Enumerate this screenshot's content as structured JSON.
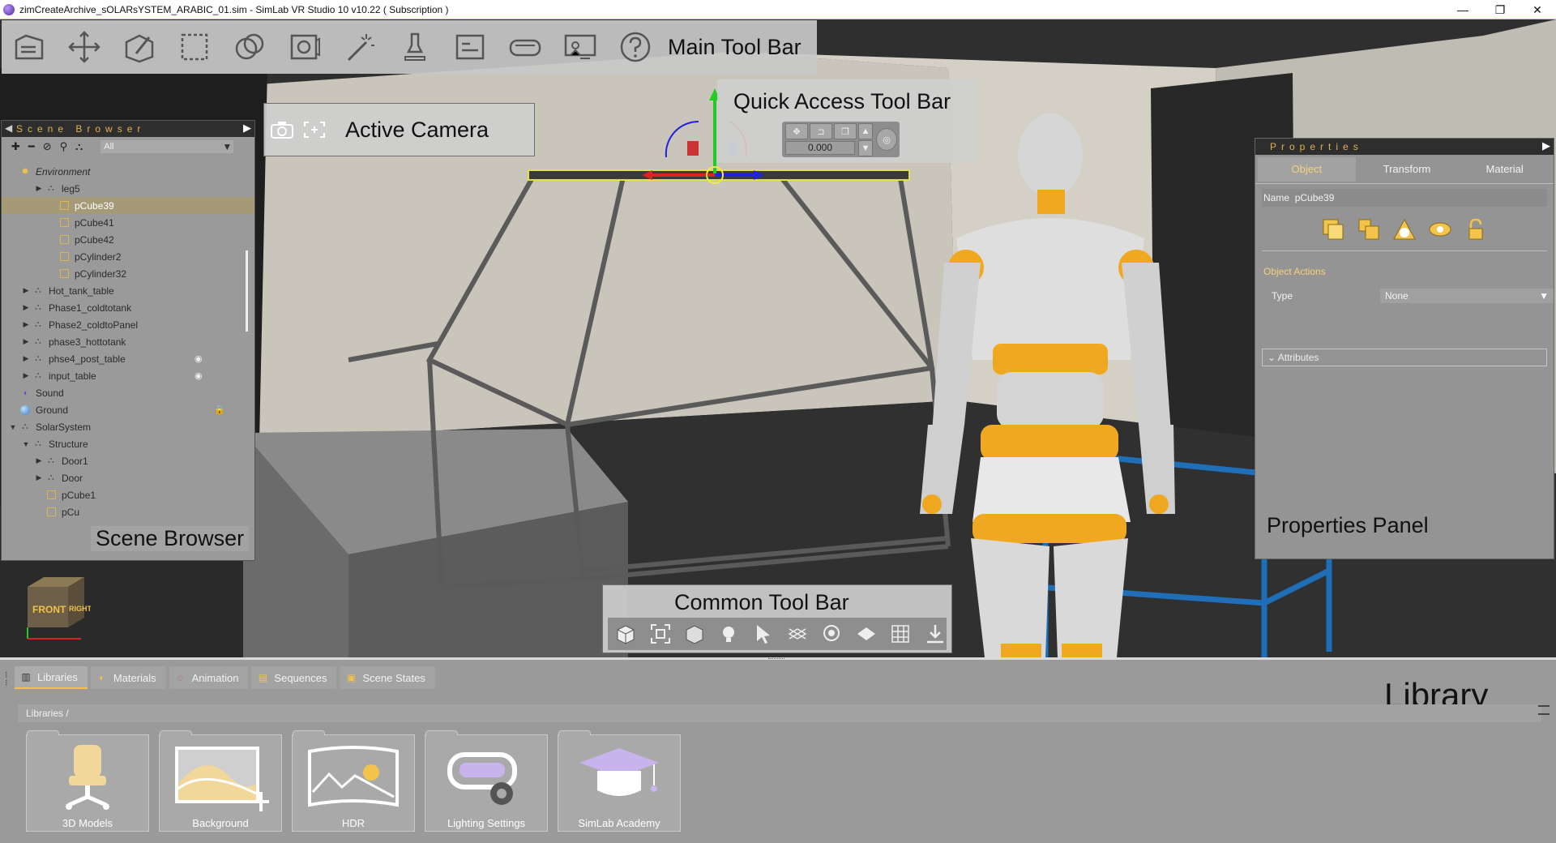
{
  "window": {
    "title": "zimCreateArchive_sOLARsYSTEM_ARABIC_01.sim - SimLab VR Studio 10 v10.22 ( Subscription )",
    "minimize": "—",
    "maximize": "❐",
    "close": "✕"
  },
  "labels": {
    "main_toolbar": "Main Tool Bar",
    "quick_access": "Quick Access Tool Bar",
    "active_camera": "Active Camera",
    "scene_browser": "Scene Browser",
    "properties_panel": "Properties Panel",
    "common_toolbar": "Common Tool Bar",
    "library": "Library"
  },
  "main_toolbar_icons": [
    "folder-icon",
    "move-icon",
    "edit-icon",
    "select-box-icon",
    "materials-icon",
    "camera-render-icon",
    "magic-wand-icon",
    "light-icon",
    "sequence-icon",
    "vr-headset-icon",
    "presentation-icon",
    "help-icon"
  ],
  "quick_access": {
    "value": "0.000"
  },
  "scene_browser": {
    "title": "Scene Browser",
    "filter": "All",
    "tree": [
      {
        "label": "Environment",
        "depth": 0,
        "icon": "sun-icon",
        "arrow": "",
        "italic": true
      },
      {
        "label": "leg5",
        "depth": 2,
        "icon": "group-icon",
        "arrow": "▶"
      },
      {
        "label": "pCube39",
        "depth": 3,
        "icon": "cube-icon",
        "arrow": "",
        "selected": true
      },
      {
        "label": "pCube41",
        "depth": 3,
        "icon": "cube-icon",
        "arrow": ""
      },
      {
        "label": "pCube42",
        "depth": 3,
        "icon": "cube-icon",
        "arrow": ""
      },
      {
        "label": "pCylinder2",
        "depth": 3,
        "icon": "cube-icon",
        "arrow": ""
      },
      {
        "label": "pCylinder32",
        "depth": 3,
        "icon": "cube-icon",
        "arrow": ""
      },
      {
        "label": "Hot_tank_table",
        "depth": 1,
        "icon": "group-icon",
        "arrow": "▶"
      },
      {
        "label": "Phase1_coldtotank",
        "depth": 1,
        "icon": "group-icon",
        "arrow": "▶"
      },
      {
        "label": "Phase2_coldtoPanel",
        "depth": 1,
        "icon": "group-icon",
        "arrow": "▶"
      },
      {
        "label": "phase3_hottotank",
        "depth": 1,
        "icon": "group-icon",
        "arrow": "▶"
      },
      {
        "label": "phse4_post_table",
        "depth": 1,
        "icon": "group-icon",
        "arrow": "▶",
        "badge": "eye-icon"
      },
      {
        "label": "input_table",
        "depth": 1,
        "icon": "group-icon",
        "arrow": "▶",
        "badge": "eye-icon"
      },
      {
        "label": "Sound",
        "depth": 0,
        "icon": "sound-icon",
        "arrow": ""
      },
      {
        "label": "Ground",
        "depth": 0,
        "icon": "globe-icon",
        "arrow": "",
        "badge": "lock-icon"
      },
      {
        "label": "SolarSystem",
        "depth": 0,
        "icon": "group-icon",
        "arrow": "▼"
      },
      {
        "label": "Structure",
        "depth": 1,
        "icon": "group-icon",
        "arrow": "▼"
      },
      {
        "label": "Door1",
        "depth": 2,
        "icon": "group-icon",
        "arrow": "▶"
      },
      {
        "label": "Door",
        "depth": 2,
        "icon": "group-icon",
        "arrow": "▶"
      },
      {
        "label": "pCube1",
        "depth": 2,
        "icon": "cube-icon",
        "arrow": ""
      },
      {
        "label": "pCu",
        "depth": 2,
        "icon": "cube-icon",
        "arrow": ""
      }
    ]
  },
  "properties": {
    "title": "Properties",
    "tabs": [
      "Object",
      "Transform",
      "Material"
    ],
    "name_label": "Name",
    "name_value": "pCube39",
    "object_actions": "Object Actions",
    "type_label": "Type",
    "type_value": "None",
    "attributes": "Attributes"
  },
  "nav_cube": {
    "front": "FRONT",
    "right": "RIGHT"
  },
  "library": {
    "tabs": [
      {
        "label": "Libraries",
        "icon": "libraries-icon"
      },
      {
        "label": "Materials",
        "icon": "materials-icon"
      },
      {
        "label": "Animation",
        "icon": "animation-icon"
      },
      {
        "label": "Sequences",
        "icon": "sequences-icon"
      },
      {
        "label": "Scene States",
        "icon": "scene-states-icon"
      }
    ],
    "breadcrumb": "Libraries  /",
    "items": [
      {
        "label": "3D Models",
        "icon": "chair-icon"
      },
      {
        "label": "Background",
        "icon": "background-icon"
      },
      {
        "label": "HDR",
        "icon": "hdr-icon"
      },
      {
        "label": "Lighting Settings",
        "icon": "lighting-settings-icon"
      },
      {
        "label": "SimLab Academy",
        "icon": "academy-icon"
      }
    ]
  },
  "colors": {
    "accent": "#e0b252",
    "panel": "#9a9a9a",
    "selected_row": "#a59a78",
    "robot_accent": "#f0a820"
  }
}
